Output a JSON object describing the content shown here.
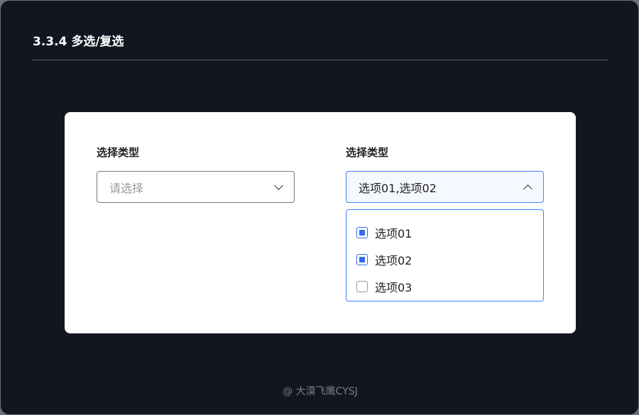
{
  "title": "3.3.4 多选/复选",
  "left": {
    "label": "选择类型",
    "placeholder": "请选择"
  },
  "right": {
    "label": "选择类型",
    "value": "选项01,选项02",
    "options": [
      {
        "label": "选项01",
        "checked": true
      },
      {
        "label": "选项02",
        "checked": true
      },
      {
        "label": "选项03",
        "checked": false
      }
    ]
  },
  "footer": "@ 大漠飞鹰CYSJ",
  "colors": {
    "accent": "#2f6df6",
    "background": "#121620"
  }
}
